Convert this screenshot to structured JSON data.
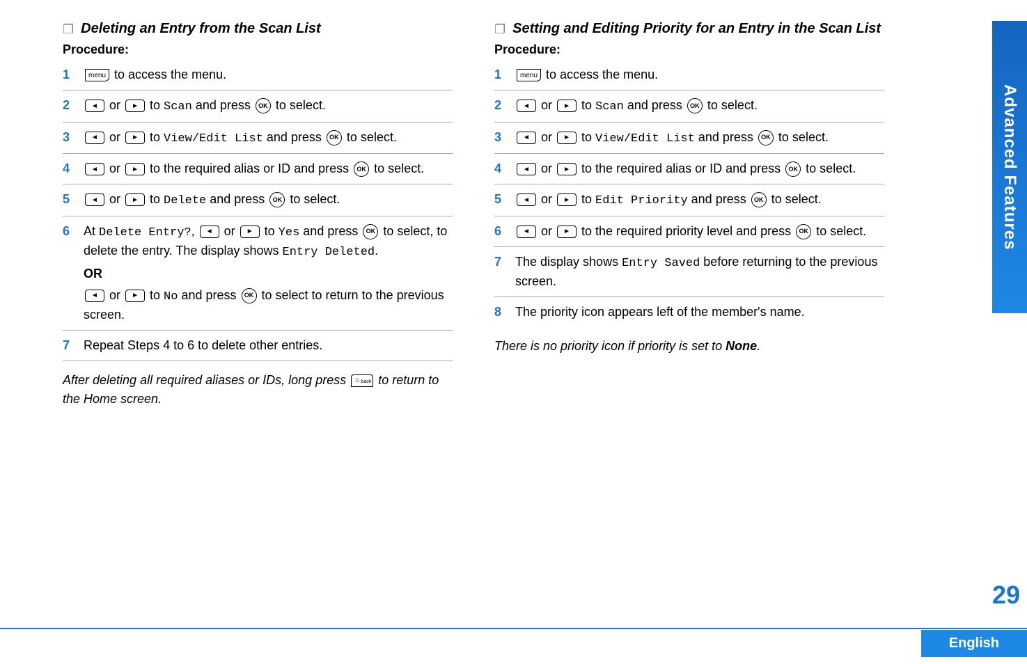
{
  "left": {
    "title": "Deleting an Entry from the Scan List",
    "procedure": "Procedure:",
    "steps": {
      "s1": {
        "num": "1",
        "text_a": " to access the menu."
      },
      "s2": {
        "num": "2",
        "text_a": " or ",
        "text_b": " to ",
        "lcd": "Scan",
        "text_c": " and press ",
        "text_d": " to select."
      },
      "s3": {
        "num": "3",
        "text_a": " or ",
        "text_b": " to ",
        "lcd": "View/Edit List",
        "text_c": " and press ",
        "text_d": " to select."
      },
      "s4": {
        "num": "4",
        "text_a": " or ",
        "text_b": " to the required alias or ID and press ",
        "text_c": " to select."
      },
      "s5": {
        "num": "5",
        "text_a": " or ",
        "text_b": " to ",
        "lcd": "Delete",
        "text_c": " and press ",
        "text_d": " to select."
      },
      "s6": {
        "num": "6",
        "text_a": "At ",
        "lcd1": "Delete Entry?",
        "text_b": ", ",
        "text_c": " or ",
        "text_d": " to ",
        "lcd2": "Yes",
        "text_e": " and press ",
        "text_f": " to select, to delete the entry. The display shows ",
        "lcd3": "Entry Deleted",
        "text_g": ".",
        "or": "OR",
        "text_h": " or ",
        "text_i": " to ",
        "lcd4": "No",
        "text_j": " and press ",
        "text_k": " to select to return to the previous screen."
      },
      "s7": {
        "num": "7",
        "text": "Repeat Steps 4 to 6 to delete other entries."
      }
    },
    "note_a": "After deleting all required aliases or IDs, long press ",
    "note_b": " to return to the Home screen."
  },
  "right": {
    "title": "Setting and Editing Priority for an Entry in the Scan List",
    "procedure": "Procedure:",
    "steps": {
      "s1": {
        "num": "1",
        "text_a": " to access the menu."
      },
      "s2": {
        "num": "2",
        "text_a": " or ",
        "text_b": " to ",
        "lcd": "Scan",
        "text_c": " and press ",
        "text_d": " to select."
      },
      "s3": {
        "num": "3",
        "text_a": " or ",
        "text_b": " to ",
        "lcd": "View/Edit List",
        "text_c": " and press ",
        "text_d": " to select."
      },
      "s4": {
        "num": "4",
        "text_a": " or ",
        "text_b": " to the required alias or ID and press ",
        "text_c": " to select."
      },
      "s5": {
        "num": "5",
        "text_a": " or ",
        "text_b": " to ",
        "lcd": "Edit Priority",
        "text_c": " and press ",
        "text_d": " to select."
      },
      "s6": {
        "num": "6",
        "text_a": " or ",
        "text_b": " to the required priority level and press ",
        "text_c": " to select."
      },
      "s7": {
        "num": "7",
        "text_a": "The display shows ",
        "lcd": "Entry Saved",
        "text_b": " before returning to the previous screen."
      },
      "s8": {
        "num": "8",
        "text": "The priority icon appears left of the member's name."
      }
    },
    "note_a": "There is no priority icon if priority is set to ",
    "note_bold": "None",
    "note_b": "."
  },
  "sideTab": "Advanced Features",
  "pageNumber": "29",
  "language": "English",
  "icons": {
    "menu": "menu"
  }
}
